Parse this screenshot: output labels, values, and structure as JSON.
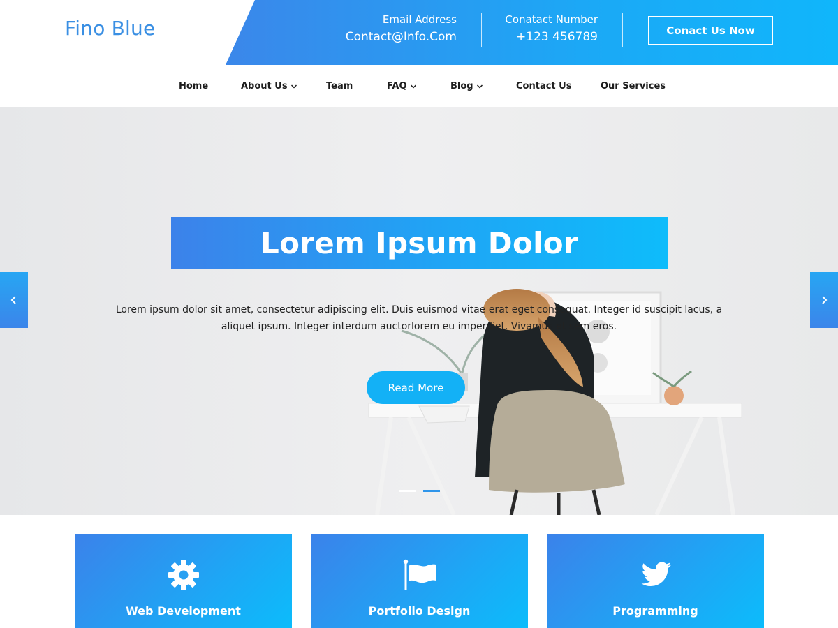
{
  "header": {
    "logo": "Fino Blue",
    "email_label": "Email Address",
    "email_value": "Contact@Info.Com",
    "phone_label": "Conatact Number",
    "phone_value": "+123 456789",
    "cta_label": "Conact Us Now"
  },
  "nav": {
    "items": [
      {
        "label": "Home",
        "has_dropdown": false
      },
      {
        "label": "About Us",
        "has_dropdown": true
      },
      {
        "label": "Team",
        "has_dropdown": false
      },
      {
        "label": "FAQ",
        "has_dropdown": true
      },
      {
        "label": "Blog",
        "has_dropdown": true
      },
      {
        "label": "Contact Us",
        "has_dropdown": false
      },
      {
        "label": "Our Services",
        "has_dropdown": false
      }
    ]
  },
  "hero": {
    "title": "Lorem Ipsum Dolor",
    "text": "Lorem ipsum dolor sit amet, consectetur adipiscing elit. Duis euismod vitae erat eget consequat. Integer id suscipit lacus, a aliquet ipsum. Integer interdum auctorlorem eu imperdiet. Vivamus et sem eros.",
    "button_label": "Read More",
    "slides_total": 2,
    "active_slide": 2,
    "prev_icon": "chevron-left-icon",
    "next_icon": "chevron-right-icon"
  },
  "services": [
    {
      "label": "Web Development",
      "icon": "gear-icon"
    },
    {
      "label": "Portfolio Design",
      "icon": "flag-icon"
    },
    {
      "label": "Programming",
      "icon": "twitter-icon"
    }
  ],
  "colors": {
    "accent": "#1ba9f6",
    "accent_dark": "#3b82ea",
    "logo": "#3a8fe3",
    "button": "#13b1f6"
  }
}
